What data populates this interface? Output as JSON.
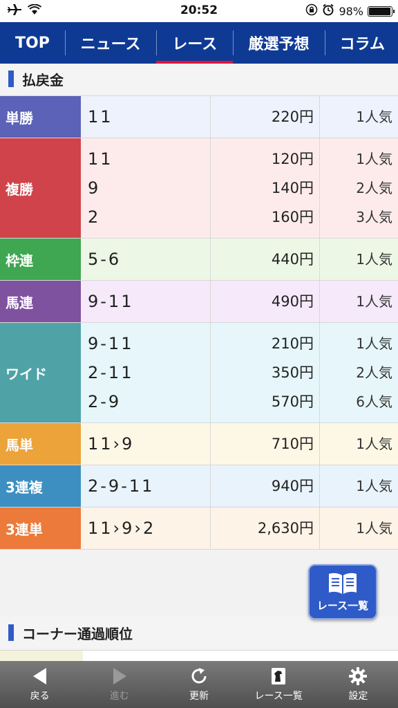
{
  "status_bar": {
    "time": "20:52",
    "battery": "98%",
    "battery_level": 0.98,
    "icons": [
      "airplane-icon",
      "wifi-icon",
      "rotation-lock-icon",
      "alarm-icon",
      "battery-icon"
    ]
  },
  "nav": {
    "tabs": [
      {
        "label": "TOP",
        "active": false
      },
      {
        "label": "ニュース",
        "active": false
      },
      {
        "label": "レース",
        "active": true
      },
      {
        "label": "厳選予想",
        "active": false
      },
      {
        "label": "コラム",
        "active": false
      }
    ],
    "active_color": "#e0143a",
    "bg_color": "#0f3a94"
  },
  "payout": {
    "title": "払戻金",
    "rows": [
      {
        "type": "単勝",
        "color": "#5b62b8",
        "bg": "#eef2fc",
        "combos": [
          "11"
        ],
        "amounts": [
          "220円"
        ],
        "pops": [
          "1人気"
        ]
      },
      {
        "type": "複勝",
        "color": "#d0434a",
        "bg": "#fdebeb",
        "combos": [
          "11",
          "9",
          "2"
        ],
        "amounts": [
          "120円",
          "140円",
          "160円"
        ],
        "pops": [
          "1人気",
          "2人気",
          "3人気"
        ]
      },
      {
        "type": "枠連",
        "color": "#3fa651",
        "bg": "#edf7e6",
        "combos": [
          "5-6"
        ],
        "amounts": [
          "440円"
        ],
        "pops": [
          "1人気"
        ]
      },
      {
        "type": "馬連",
        "color": "#7f52a0",
        "bg": "#f5e9fa",
        "combos": [
          "9-11"
        ],
        "amounts": [
          "490円"
        ],
        "pops": [
          "1人気"
        ]
      },
      {
        "type": "ワイド",
        "color": "#4fa3a7",
        "bg": "#e6f6fa",
        "combos": [
          "9-11",
          "2-11",
          "2-9"
        ],
        "amounts": [
          "210円",
          "350円",
          "570円"
        ],
        "pops": [
          "1人気",
          "2人気",
          "6人気"
        ]
      },
      {
        "type": "馬単",
        "color": "#eba33a",
        "bg": "#fdf8e6",
        "combos": [
          "11›9"
        ],
        "amounts": [
          "710円"
        ],
        "pops": [
          "1人気"
        ]
      },
      {
        "type": "3連複",
        "color": "#3d8fc2",
        "bg": "#e8f3fc",
        "combos": [
          "2-9-11"
        ],
        "amounts": [
          "940円"
        ],
        "pops": [
          "1人気"
        ]
      },
      {
        "type": "3連単",
        "color": "#ec7a3a",
        "bg": "#fdf3e6",
        "combos": [
          "11›9›2"
        ],
        "amounts": [
          "2,630円"
        ],
        "pops": [
          "1人気"
        ]
      }
    ]
  },
  "corner": {
    "title": "コーナー通過順位"
  },
  "float_button": {
    "label": "レース一覧",
    "icon": "book-icon"
  },
  "toolbar": {
    "items": [
      {
        "label": "戻る",
        "icon": "back-arrow-icon",
        "enabled": true
      },
      {
        "label": "進む",
        "icon": "forward-arrow-icon",
        "enabled": false
      },
      {
        "label": "更新",
        "icon": "refresh-icon",
        "enabled": true
      },
      {
        "label": "レース一覧",
        "icon": "horse-card-icon",
        "enabled": true
      },
      {
        "label": "設定",
        "icon": "gear-icon",
        "enabled": true
      }
    ]
  }
}
